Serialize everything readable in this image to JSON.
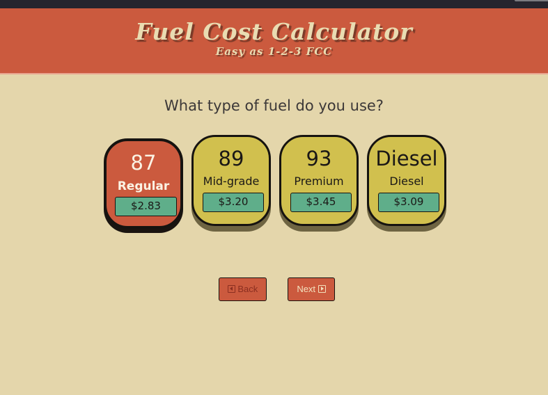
{
  "header": {
    "title": "Fuel Cost Calculator",
    "subtitle": "Easy as 1-2-3 FCC"
  },
  "question": "What type of fuel do you use?",
  "fuel_options": [
    {
      "grade": "87",
      "name": "Regular",
      "price": "$2.83",
      "selected": true
    },
    {
      "grade": "89",
      "name": "Mid-grade",
      "price": "$3.20",
      "selected": false
    },
    {
      "grade": "93",
      "name": "Premium",
      "price": "$3.45",
      "selected": false
    },
    {
      "grade": "Diesel",
      "name": "Diesel",
      "price": "$3.09",
      "selected": false
    }
  ],
  "nav": {
    "back_label": "Back",
    "back_icon": "caret-square-left-icon",
    "next_label": "Next",
    "next_icon": "caret-square-right-icon"
  },
  "colors": {
    "background": "#e4d6ab",
    "header": "#cb5a3e",
    "card": "#d1c04e",
    "selected_card": "#cb5a3e",
    "price_badge": "#5fae8a"
  }
}
